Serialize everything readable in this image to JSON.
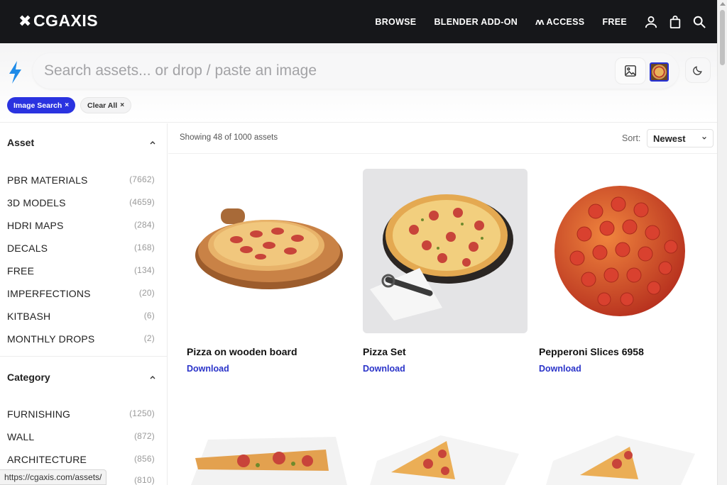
{
  "nav": {
    "logo": "CGAXIS",
    "links": [
      "BROWSE",
      "BLENDER ADD-ON",
      "ACCESS",
      "FREE"
    ],
    "icons": [
      "user-icon",
      "bag-icon",
      "search-icon"
    ]
  },
  "search": {
    "placeholder": "Search assets... or drop / paste an image",
    "chips": {
      "image_search": "Image Search",
      "clear_all": "Clear All"
    },
    "chip_close": "×"
  },
  "sidebar": {
    "asset": {
      "heading": "Asset",
      "items": [
        {
          "label": "PBR MATERIALS",
          "count": "(7662)"
        },
        {
          "label": "3D MODELS",
          "count": "(4659)"
        },
        {
          "label": "HDRI MAPS",
          "count": "(284)"
        },
        {
          "label": "DECALS",
          "count": "(168)"
        },
        {
          "label": "FREE",
          "count": "(134)"
        },
        {
          "label": "IMPERFECTIONS",
          "count": "(20)"
        },
        {
          "label": "KITBASH",
          "count": "(6)"
        },
        {
          "label": "MONTHLY DROPS",
          "count": "(2)"
        }
      ]
    },
    "category": {
      "heading": "Category",
      "items": [
        {
          "label": "FURNISHING",
          "count": "(1250)"
        },
        {
          "label": "WALL",
          "count": "(872)"
        },
        {
          "label": "ARCHITECTURE",
          "count": "(856)"
        },
        {
          "label": "",
          "count": "(810)"
        }
      ]
    }
  },
  "results": {
    "showing": "Showing 48 of 1000 assets",
    "sort_label": "Sort:",
    "sort_value": "Newest",
    "cards": [
      {
        "title": "Pizza on wooden board",
        "action": "Download"
      },
      {
        "title": "Pizza Set",
        "action": "Download"
      },
      {
        "title": "Pepperoni Slices 6958",
        "action": "Download"
      }
    ]
  },
  "statusbar": {
    "url": "https://cgaxis.com/assets/"
  },
  "colors": {
    "nav_bg": "#16171a",
    "accent": "#2a33e0",
    "link": "#2a33c9"
  }
}
